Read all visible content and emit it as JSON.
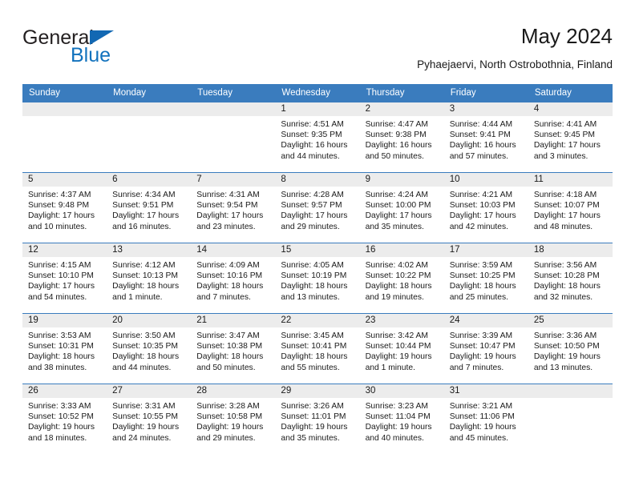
{
  "brand": {
    "name_top": "General",
    "name_bottom": "Blue",
    "accent_color": "#1272bd",
    "triangle_color": "#1268b3"
  },
  "header": {
    "title": "May 2024",
    "subtitle": "Pyhaejaervi, North Ostrobothnia, Finland"
  },
  "calendar": {
    "header_bg": "#3a7cbe",
    "daynum_bg": "#ececec",
    "weekdays": [
      "Sunday",
      "Monday",
      "Tuesday",
      "Wednesday",
      "Thursday",
      "Friday",
      "Saturday"
    ],
    "weeks": [
      [
        {
          "day": "",
          "empty": true
        },
        {
          "day": "",
          "empty": true
        },
        {
          "day": "",
          "empty": true
        },
        {
          "day": "1",
          "sunrise": "Sunrise: 4:51 AM",
          "sunset": "Sunset: 9:35 PM",
          "daylight": "Daylight: 16 hours and 44 minutes."
        },
        {
          "day": "2",
          "sunrise": "Sunrise: 4:47 AM",
          "sunset": "Sunset: 9:38 PM",
          "daylight": "Daylight: 16 hours and 50 minutes."
        },
        {
          "day": "3",
          "sunrise": "Sunrise: 4:44 AM",
          "sunset": "Sunset: 9:41 PM",
          "daylight": "Daylight: 16 hours and 57 minutes."
        },
        {
          "day": "4",
          "sunrise": "Sunrise: 4:41 AM",
          "sunset": "Sunset: 9:45 PM",
          "daylight": "Daylight: 17 hours and 3 minutes."
        }
      ],
      [
        {
          "day": "5",
          "sunrise": "Sunrise: 4:37 AM",
          "sunset": "Sunset: 9:48 PM",
          "daylight": "Daylight: 17 hours and 10 minutes."
        },
        {
          "day": "6",
          "sunrise": "Sunrise: 4:34 AM",
          "sunset": "Sunset: 9:51 PM",
          "daylight": "Daylight: 17 hours and 16 minutes."
        },
        {
          "day": "7",
          "sunrise": "Sunrise: 4:31 AM",
          "sunset": "Sunset: 9:54 PM",
          "daylight": "Daylight: 17 hours and 23 minutes."
        },
        {
          "day": "8",
          "sunrise": "Sunrise: 4:28 AM",
          "sunset": "Sunset: 9:57 PM",
          "daylight": "Daylight: 17 hours and 29 minutes."
        },
        {
          "day": "9",
          "sunrise": "Sunrise: 4:24 AM",
          "sunset": "Sunset: 10:00 PM",
          "daylight": "Daylight: 17 hours and 35 minutes."
        },
        {
          "day": "10",
          "sunrise": "Sunrise: 4:21 AM",
          "sunset": "Sunset: 10:03 PM",
          "daylight": "Daylight: 17 hours and 42 minutes."
        },
        {
          "day": "11",
          "sunrise": "Sunrise: 4:18 AM",
          "sunset": "Sunset: 10:07 PM",
          "daylight": "Daylight: 17 hours and 48 minutes."
        }
      ],
      [
        {
          "day": "12",
          "sunrise": "Sunrise: 4:15 AM",
          "sunset": "Sunset: 10:10 PM",
          "daylight": "Daylight: 17 hours and 54 minutes."
        },
        {
          "day": "13",
          "sunrise": "Sunrise: 4:12 AM",
          "sunset": "Sunset: 10:13 PM",
          "daylight": "Daylight: 18 hours and 1 minute."
        },
        {
          "day": "14",
          "sunrise": "Sunrise: 4:09 AM",
          "sunset": "Sunset: 10:16 PM",
          "daylight": "Daylight: 18 hours and 7 minutes."
        },
        {
          "day": "15",
          "sunrise": "Sunrise: 4:05 AM",
          "sunset": "Sunset: 10:19 PM",
          "daylight": "Daylight: 18 hours and 13 minutes."
        },
        {
          "day": "16",
          "sunrise": "Sunrise: 4:02 AM",
          "sunset": "Sunset: 10:22 PM",
          "daylight": "Daylight: 18 hours and 19 minutes."
        },
        {
          "day": "17",
          "sunrise": "Sunrise: 3:59 AM",
          "sunset": "Sunset: 10:25 PM",
          "daylight": "Daylight: 18 hours and 25 minutes."
        },
        {
          "day": "18",
          "sunrise": "Sunrise: 3:56 AM",
          "sunset": "Sunset: 10:28 PM",
          "daylight": "Daylight: 18 hours and 32 minutes."
        }
      ],
      [
        {
          "day": "19",
          "sunrise": "Sunrise: 3:53 AM",
          "sunset": "Sunset: 10:31 PM",
          "daylight": "Daylight: 18 hours and 38 minutes."
        },
        {
          "day": "20",
          "sunrise": "Sunrise: 3:50 AM",
          "sunset": "Sunset: 10:35 PM",
          "daylight": "Daylight: 18 hours and 44 minutes."
        },
        {
          "day": "21",
          "sunrise": "Sunrise: 3:47 AM",
          "sunset": "Sunset: 10:38 PM",
          "daylight": "Daylight: 18 hours and 50 minutes."
        },
        {
          "day": "22",
          "sunrise": "Sunrise: 3:45 AM",
          "sunset": "Sunset: 10:41 PM",
          "daylight": "Daylight: 18 hours and 55 minutes."
        },
        {
          "day": "23",
          "sunrise": "Sunrise: 3:42 AM",
          "sunset": "Sunset: 10:44 PM",
          "daylight": "Daylight: 19 hours and 1 minute."
        },
        {
          "day": "24",
          "sunrise": "Sunrise: 3:39 AM",
          "sunset": "Sunset: 10:47 PM",
          "daylight": "Daylight: 19 hours and 7 minutes."
        },
        {
          "day": "25",
          "sunrise": "Sunrise: 3:36 AM",
          "sunset": "Sunset: 10:50 PM",
          "daylight": "Daylight: 19 hours and 13 minutes."
        }
      ],
      [
        {
          "day": "26",
          "sunrise": "Sunrise: 3:33 AM",
          "sunset": "Sunset: 10:52 PM",
          "daylight": "Daylight: 19 hours and 18 minutes."
        },
        {
          "day": "27",
          "sunrise": "Sunrise: 3:31 AM",
          "sunset": "Sunset: 10:55 PM",
          "daylight": "Daylight: 19 hours and 24 minutes."
        },
        {
          "day": "28",
          "sunrise": "Sunrise: 3:28 AM",
          "sunset": "Sunset: 10:58 PM",
          "daylight": "Daylight: 19 hours and 29 minutes."
        },
        {
          "day": "29",
          "sunrise": "Sunrise: 3:26 AM",
          "sunset": "Sunset: 11:01 PM",
          "daylight": "Daylight: 19 hours and 35 minutes."
        },
        {
          "day": "30",
          "sunrise": "Sunrise: 3:23 AM",
          "sunset": "Sunset: 11:04 PM",
          "daylight": "Daylight: 19 hours and 40 minutes."
        },
        {
          "day": "31",
          "sunrise": "Sunrise: 3:21 AM",
          "sunset": "Sunset: 11:06 PM",
          "daylight": "Daylight: 19 hours and 45 minutes."
        },
        {
          "day": "",
          "empty": true
        }
      ]
    ]
  }
}
